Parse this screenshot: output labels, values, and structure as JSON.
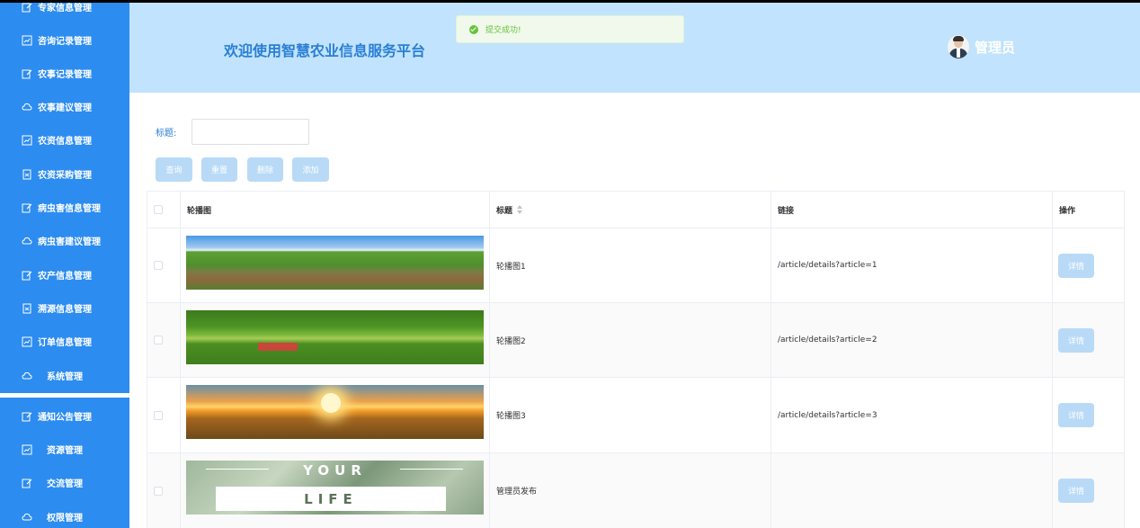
{
  "sidebar": {
    "items": [
      {
        "label": "专家信息管理",
        "icon": "edit-icon"
      },
      {
        "label": "咨询记录管理",
        "icon": "chart-icon"
      },
      {
        "label": "农事记录管理",
        "icon": "edit-icon"
      },
      {
        "label": "农事建议管理",
        "icon": "cloud-icon"
      },
      {
        "label": "农资信息管理",
        "icon": "chart-icon"
      },
      {
        "label": "农资采购管理",
        "icon": "document-icon"
      },
      {
        "label": "病虫害信息管理",
        "icon": "edit-icon"
      },
      {
        "label": "病虫害建议管理",
        "icon": "cloud-icon"
      },
      {
        "label": "农产信息管理",
        "icon": "edit-icon"
      },
      {
        "label": "溯源信息管理",
        "icon": "document-icon"
      },
      {
        "label": "订单信息管理",
        "icon": "chart-icon"
      },
      {
        "label": "系统管理",
        "icon": "cloud-icon"
      },
      {
        "label": "通知公告管理",
        "icon": "edit-icon"
      },
      {
        "label": "资源管理",
        "icon": "chart-icon"
      },
      {
        "label": "交流管理",
        "icon": "edit-icon"
      },
      {
        "label": "权限管理",
        "icon": "cloud-icon"
      }
    ]
  },
  "header": {
    "title": "欢迎使用智慧农业信息服务平台",
    "user_name": "管理员"
  },
  "toast": {
    "message": "提交成功!",
    "color": "#67c23a"
  },
  "filter": {
    "title_label": "标题:",
    "title_value": "",
    "query_label": "查询",
    "reset_label": "重置",
    "delete_label": "删除",
    "add_label": "添加"
  },
  "table": {
    "headers": {
      "image": "轮播图",
      "title": "标题",
      "link": "链接",
      "action": "操作"
    },
    "rows": [
      {
        "title": "轮播图1",
        "link": "/article/details?article=1",
        "detail_label": "详情"
      },
      {
        "title": "轮播图2",
        "link": "/article/details?article=2",
        "detail_label": "详情"
      },
      {
        "title": "轮播图3",
        "link": "/article/details?article=3",
        "detail_label": "详情"
      },
      {
        "title": "管理员发布",
        "link": "",
        "detail_label": "详情",
        "image_text_top": "YOUR",
        "image_text_bottom": "LIFE"
      }
    ]
  },
  "colors": {
    "sidebar": "#2d8cf0",
    "header": "#c1e3fd",
    "button": "#b8daf7",
    "title": "#2a7fd4"
  }
}
